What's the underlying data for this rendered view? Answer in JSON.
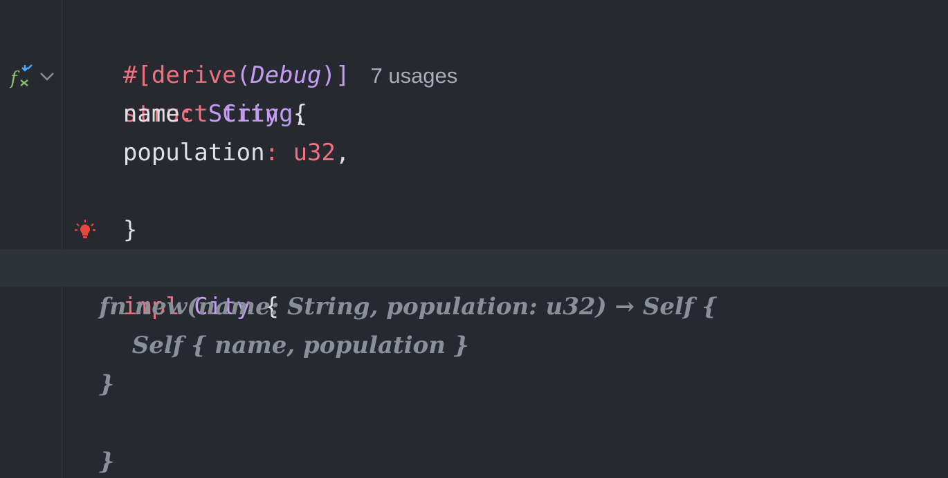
{
  "editor": {
    "lines": {
      "attr_hash": "#[",
      "attr_name": "derive",
      "attr_open": "(",
      "attr_arg": "Debug",
      "attr_close": ")]",
      "usages": "7 usages",
      "struct_kw": "struct",
      "struct_name": "City",
      "open_brace": "{",
      "field1_name": "name",
      "field1_colon": ":",
      "field1_type": "String",
      "field1_comma": ",",
      "field2_name": "population",
      "field2_colon": ":",
      "field2_type": "u32",
      "field2_comma": ",",
      "close_brace": "}",
      "impl_kw": "impl",
      "impl_name": "City",
      "impl_open": "{",
      "fn_line": "fn new(name: String, population: u32) → Self {",
      "self_line": "Self { name, population }",
      "fn_close": "}",
      "impl_close": "}"
    },
    "icons": {
      "gutter_function": "function-run-icon",
      "gutter_fold": "chevron-down-icon",
      "intention": "lightbulb-icon"
    },
    "colors": {
      "background": "#262a30",
      "keyword": "#f0707e",
      "type": "#c39cf2",
      "text": "#dfe1e5",
      "folded": "#8a8f98",
      "bulb": "#e8473d"
    }
  }
}
